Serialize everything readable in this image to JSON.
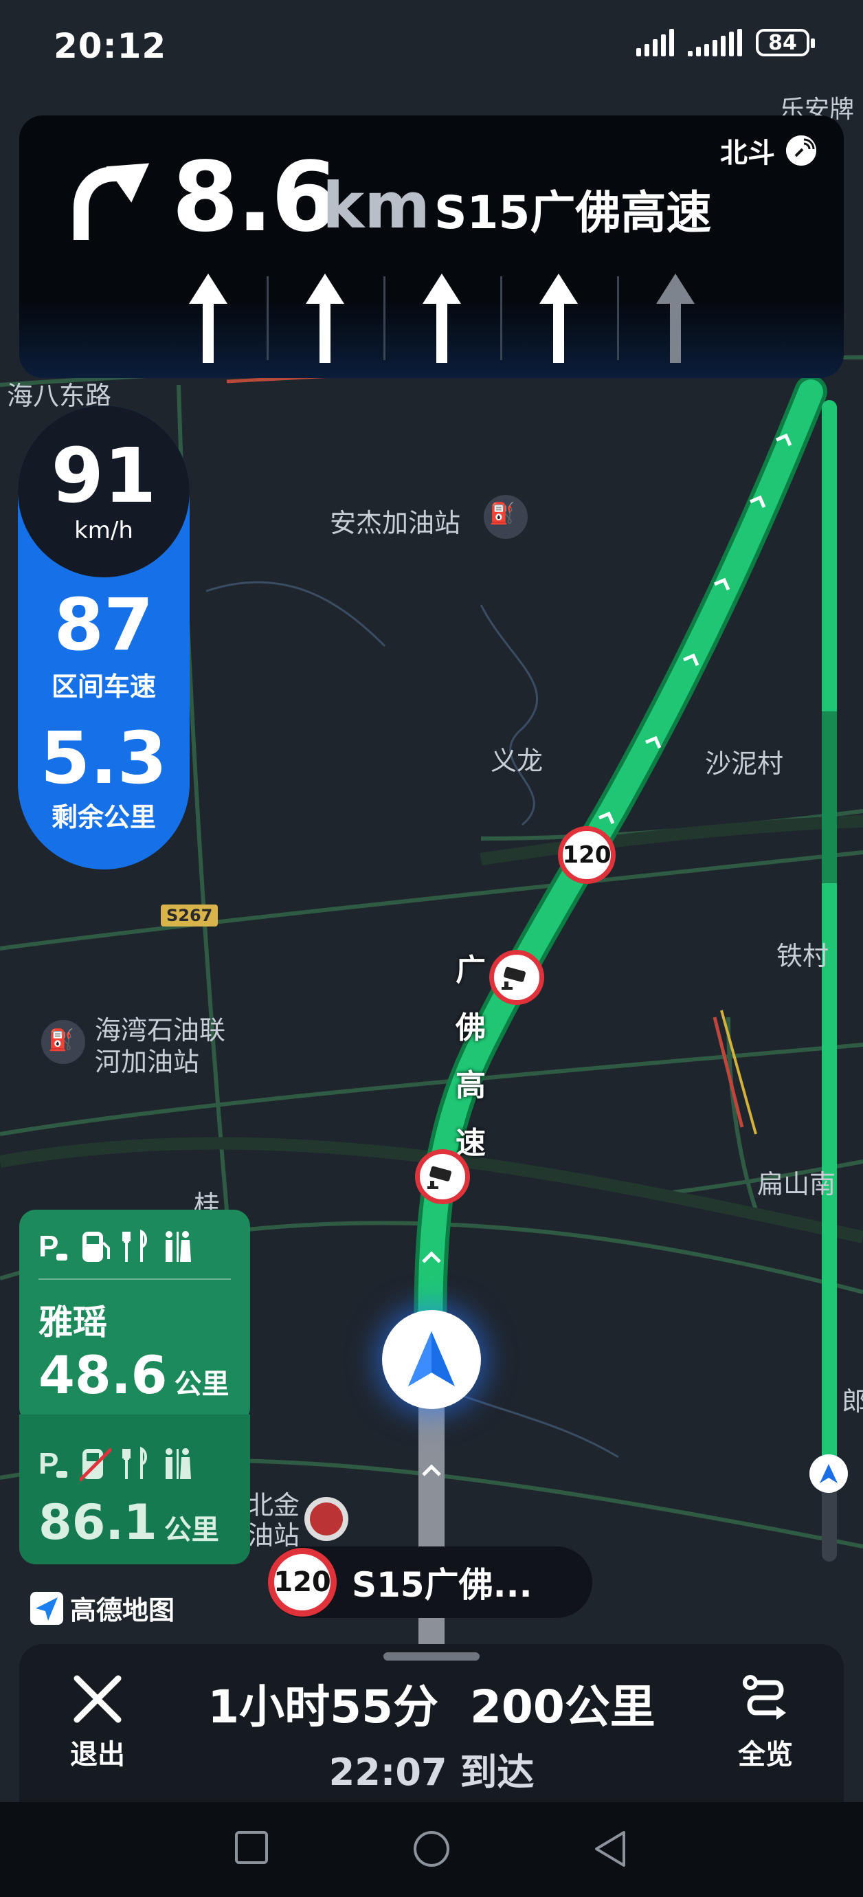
{
  "status_bar": {
    "time": "20:12",
    "battery": "84"
  },
  "guidance": {
    "distance": "8.6",
    "unit": "km",
    "road": "S15广佛高速",
    "beidou": "北斗",
    "lanes": [
      "straight",
      "straight",
      "straight",
      "straight",
      "straight-dim"
    ]
  },
  "speed": {
    "current": "91",
    "unit": "km/h",
    "average": "87",
    "average_label": "区间车速",
    "remaining": "5.3",
    "remaining_label": "剩余公里"
  },
  "map_labels": {
    "top_right": "乐安牌",
    "road_left": "海八东路",
    "gas1": "安杰加油站",
    "village1": "义龙",
    "village2": "沙泥村",
    "expressway": "广佛高速",
    "right1": "铁村",
    "gas2_line1": "海湾石油联",
    "gas2_line2": "河加油站",
    "right2": "扁山南",
    "left_mid": "桂",
    "bottom_left_line1": "北金",
    "bottom_left_line2": "油站",
    "route_shield": "S267",
    "speed_limit_marker": "120",
    "right_edge": "郎"
  },
  "service_areas": [
    {
      "name": "雅瑶",
      "distance": "48.6",
      "unit": "公里"
    },
    {
      "name": "",
      "distance": "86.1",
      "unit": "公里"
    }
  ],
  "logo": "高德地图",
  "current_road": {
    "limit": "120",
    "name": "S15广佛..."
  },
  "trip": {
    "summary": "1小时55分  200公里",
    "eta": "22:07 到达",
    "exit_label": "退出",
    "overview_label": "全览"
  },
  "colors": {
    "route": "#1fc774",
    "panel_blue": "#1671e9",
    "service_green": "#1c8a5b",
    "limit_red": "#e0323b"
  }
}
